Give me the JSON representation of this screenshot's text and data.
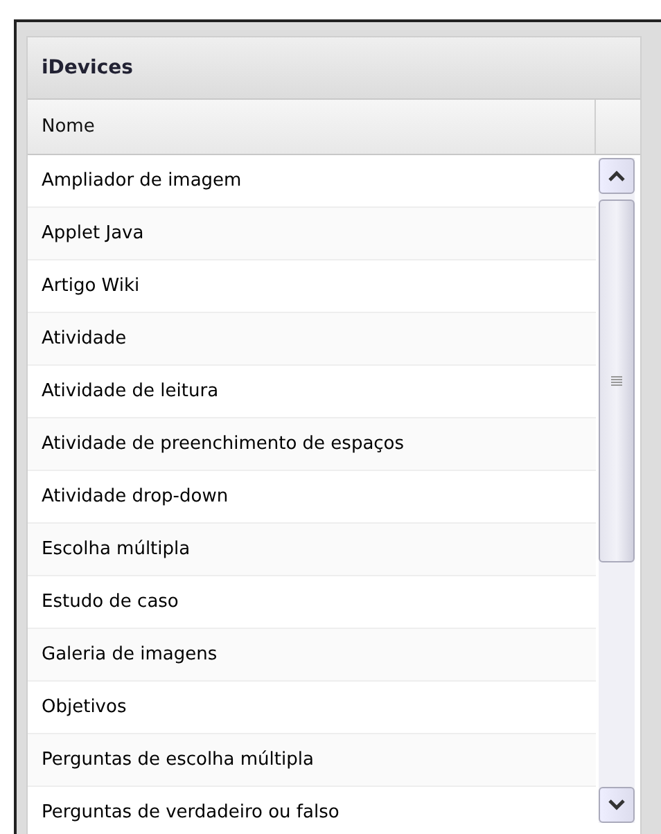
{
  "panel": {
    "title": "iDevices"
  },
  "table": {
    "columns": [
      "Nome"
    ],
    "rows": [
      {
        "name": "Ampliador de imagem"
      },
      {
        "name": "Applet Java"
      },
      {
        "name": "Artigo Wiki"
      },
      {
        "name": "Atividade"
      },
      {
        "name": "Atividade de leitura"
      },
      {
        "name": "Atividade de preenchimento de espaços"
      },
      {
        "name": "Atividade drop-down"
      },
      {
        "name": "Escolha múltipla"
      },
      {
        "name": "Estudo de caso"
      },
      {
        "name": "Galeria de imagens"
      },
      {
        "name": "Objetivos"
      },
      {
        "name": "Perguntas de escolha múltipla"
      },
      {
        "name": "Perguntas de verdadeiro ou falso"
      }
    ]
  }
}
